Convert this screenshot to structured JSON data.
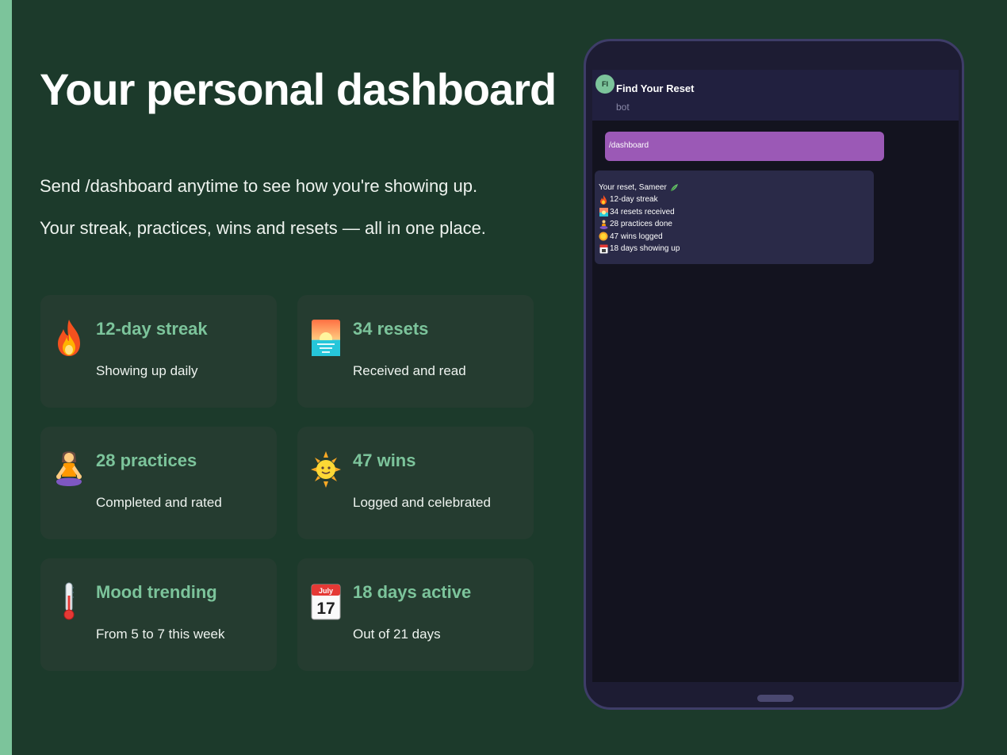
{
  "page": {
    "title": "Your personal dashboard",
    "intro_line_1": "Send /dashboard anytime to see how you're showing up.",
    "intro_line_2": "Your streak, practices, wins and resets — all in one place."
  },
  "colors": {
    "background": "#1c3a2b",
    "accent": "#7cc49b",
    "card": "#253c30",
    "tablet_frame": "#1d1c33",
    "outgoing_bubble": "#9b59b6",
    "incoming_bubble": "#2a2a48"
  },
  "cards": [
    {
      "icon": "fire-icon",
      "title": "12-day streak",
      "subtitle": "Showing up daily"
    },
    {
      "icon": "sunrise-icon",
      "title": "34 resets",
      "subtitle": "Received and read"
    },
    {
      "icon": "meditation-icon",
      "title": "28 practices",
      "subtitle": "Completed and rated"
    },
    {
      "icon": "sun-face-icon",
      "title": "47 wins",
      "subtitle": "Logged and celebrated"
    },
    {
      "icon": "thermometer-icon",
      "title": "Mood trending",
      "subtitle": "From 5 to 7 this week"
    },
    {
      "icon": "calendar-icon",
      "title": "18 days active",
      "subtitle": "Out of 21 days",
      "calendar_month": "July",
      "calendar_day": "17"
    }
  ],
  "chat": {
    "avatar_initials": "FI",
    "name": "Find Your Reset",
    "subtitle": "bot",
    "outgoing": "/dashboard",
    "reply_heading": "Your reset, Sameer",
    "reply_lines": [
      {
        "icon": "fire-icon",
        "text": "12-day streak"
      },
      {
        "icon": "sunrise-icon",
        "text": "34 resets received"
      },
      {
        "icon": "meditation-icon",
        "text": "28 practices done"
      },
      {
        "icon": "sun-face-icon",
        "text": "47 wins logged"
      },
      {
        "icon": "calendar-icon",
        "text": "18 days showing up"
      }
    ]
  }
}
